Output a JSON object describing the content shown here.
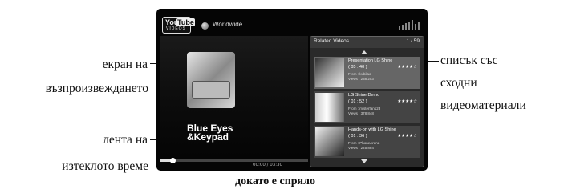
{
  "callouts": {
    "screen": [
      "екран на",
      "възпроизвеждането"
    ],
    "elapsed": [
      "лента на",
      "изтеклото време"
    ],
    "related": [
      "списък със",
      "сходни",
      "видеоматериали"
    ]
  },
  "caption": "докато е спряло",
  "player": {
    "logo": {
      "you": "You",
      "tube": "Tube",
      "sub": "VIDEOS"
    },
    "region": "Worldwide",
    "video_title": [
      "Blue Eyes",
      "&Keypad"
    ],
    "elapsed_time": "00:00 / 03:30",
    "progress": 0.08
  },
  "related": {
    "title": "Related Videos",
    "page": "1 / 59",
    "items": [
      {
        "title": "Presentation LG Shine",
        "duration": "( 05 : 40 )",
        "from": "From : kubilao",
        "views": "Views : 238,253",
        "rating": "★★★★☆"
      },
      {
        "title": "LG Shine Demo",
        "duration": "( 01 : 52 )",
        "from": "From : misterfan123",
        "views": "Views : 378,848",
        "rating": "★★★★☆"
      },
      {
        "title": "Hands-on with LG Shine",
        "duration": "( 01 : 36 )",
        "from": "From : PhoneArena",
        "views": "Views : 225,884",
        "rating": "★★★★☆"
      }
    ]
  }
}
